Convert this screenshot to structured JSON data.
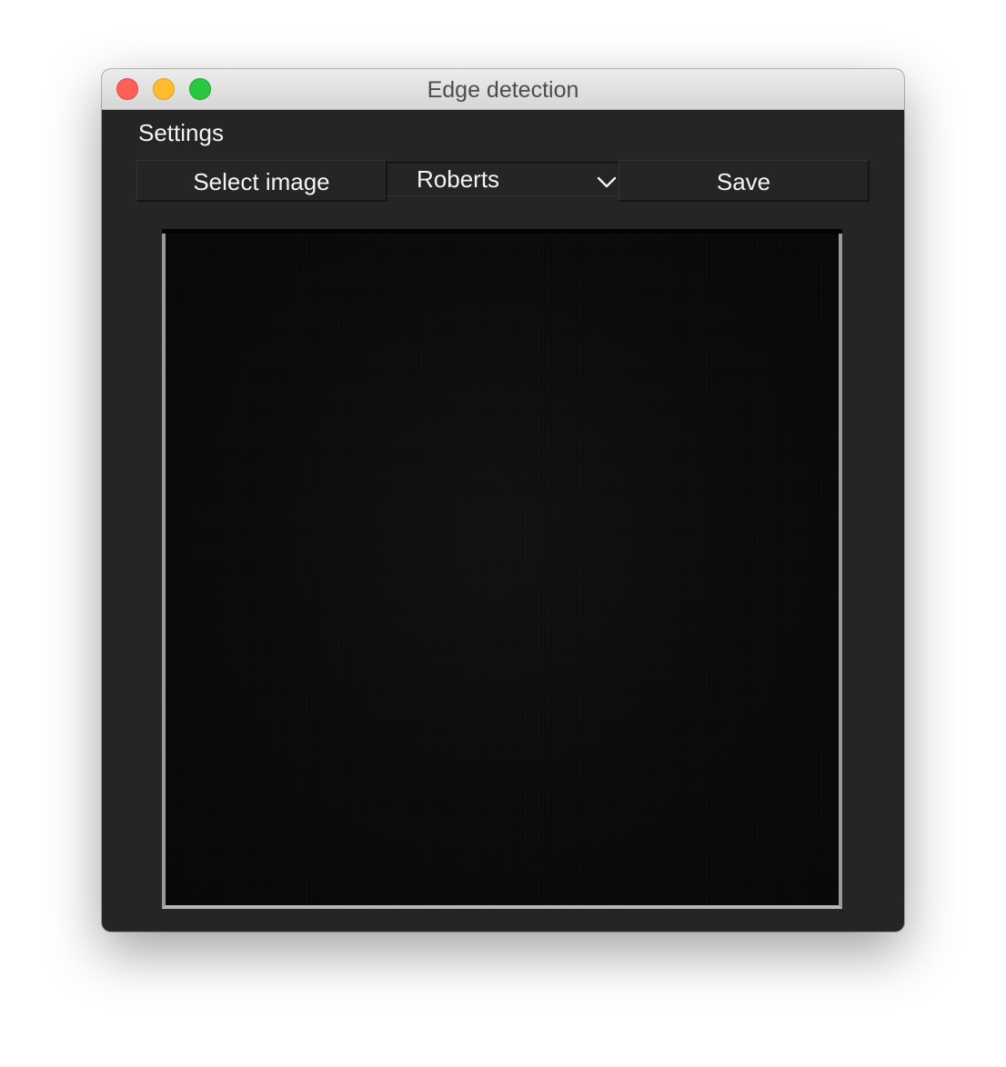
{
  "window": {
    "title": "Edge detection",
    "traffic_lights": {
      "close_color": "#fe5f57",
      "minimize_color": "#febc2e",
      "maximize_color": "#28c840"
    }
  },
  "settings": {
    "label": "Settings"
  },
  "toolbar": {
    "select_image_label": "Select image",
    "method_value": "Roberts",
    "save_label": "Save",
    "dropdown_icon": "chevron-down-icon"
  },
  "preview": {
    "content": "black edge-detection output"
  }
}
